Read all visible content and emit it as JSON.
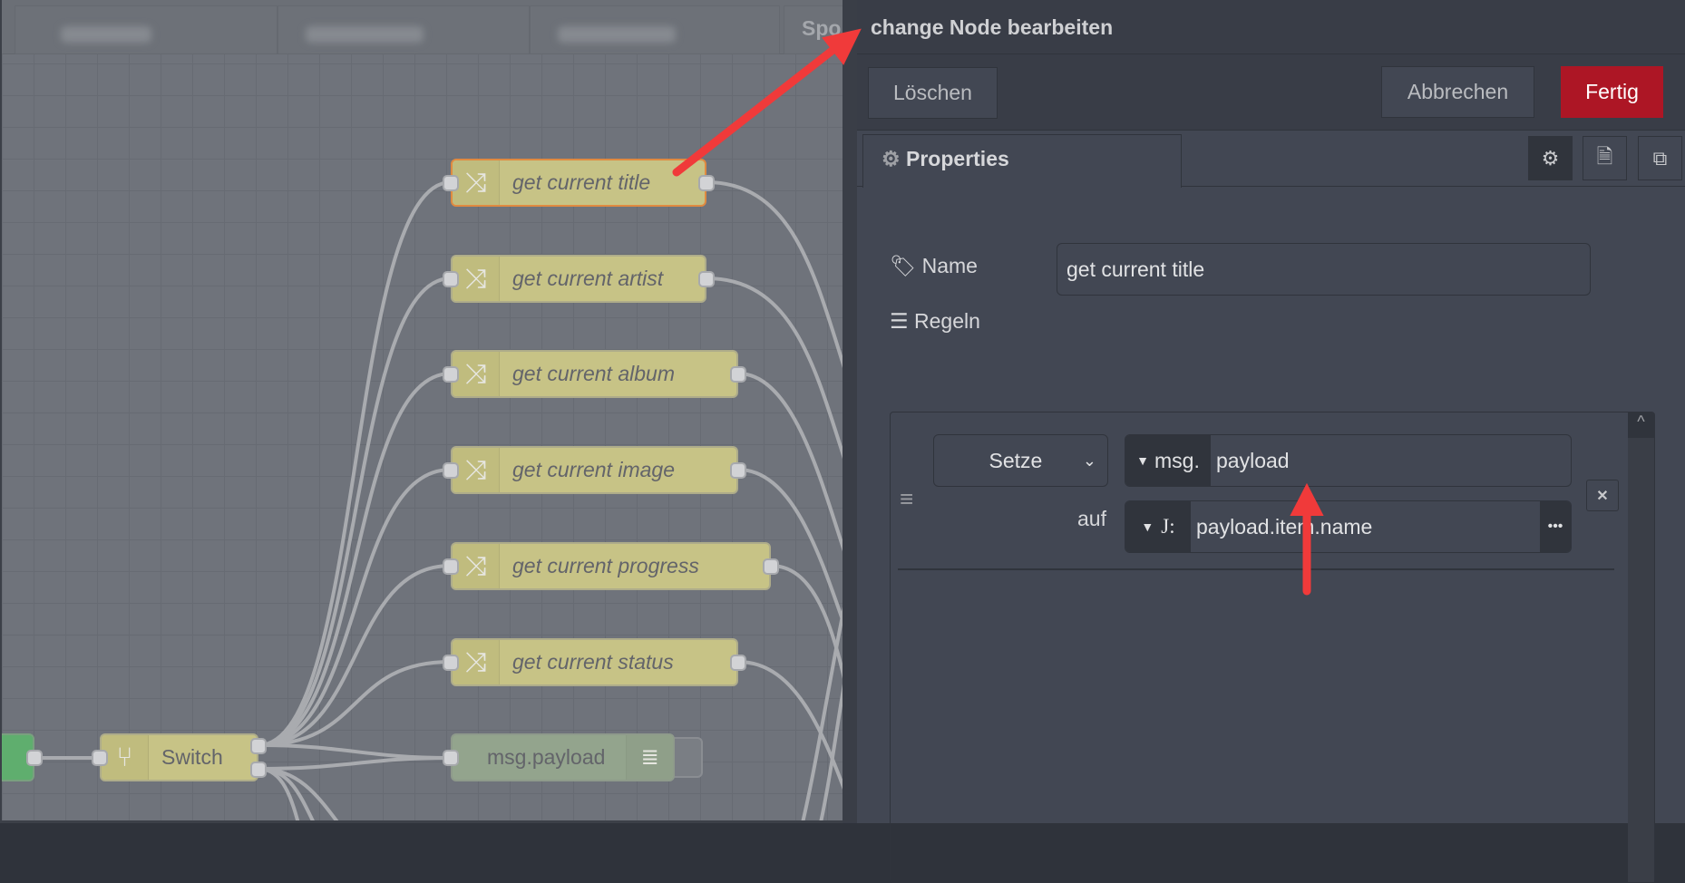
{
  "canvas": {
    "tab_visible_text": "Spo",
    "nodes": [
      {
        "label": "get current title",
        "type": "change",
        "selected": true
      },
      {
        "label": "get current artist",
        "type": "change"
      },
      {
        "label": "get current album",
        "type": "change"
      },
      {
        "label": "get current image",
        "type": "change"
      },
      {
        "label": "get current progress",
        "type": "change"
      },
      {
        "label": "get current status",
        "type": "change"
      },
      {
        "label": "Switch",
        "type": "switch"
      },
      {
        "label": "msg.payload",
        "type": "debug"
      }
    ]
  },
  "panel": {
    "title": "change Node bearbeiten",
    "delete_label": "Löschen",
    "cancel_label": "Abbrechen",
    "done_label": "Fertig",
    "done_color": "#ad1625",
    "tab_label": "Properties",
    "name_label": "Name",
    "name_value": "get current title",
    "rules_label": "Regeln",
    "rule": {
      "action": "Setze",
      "target_prefix": "msg.",
      "target_value": "payload",
      "to_label": "auf",
      "value_type": "J:",
      "value": "payload.item.name"
    }
  },
  "annotation_color": "#f03a3a"
}
